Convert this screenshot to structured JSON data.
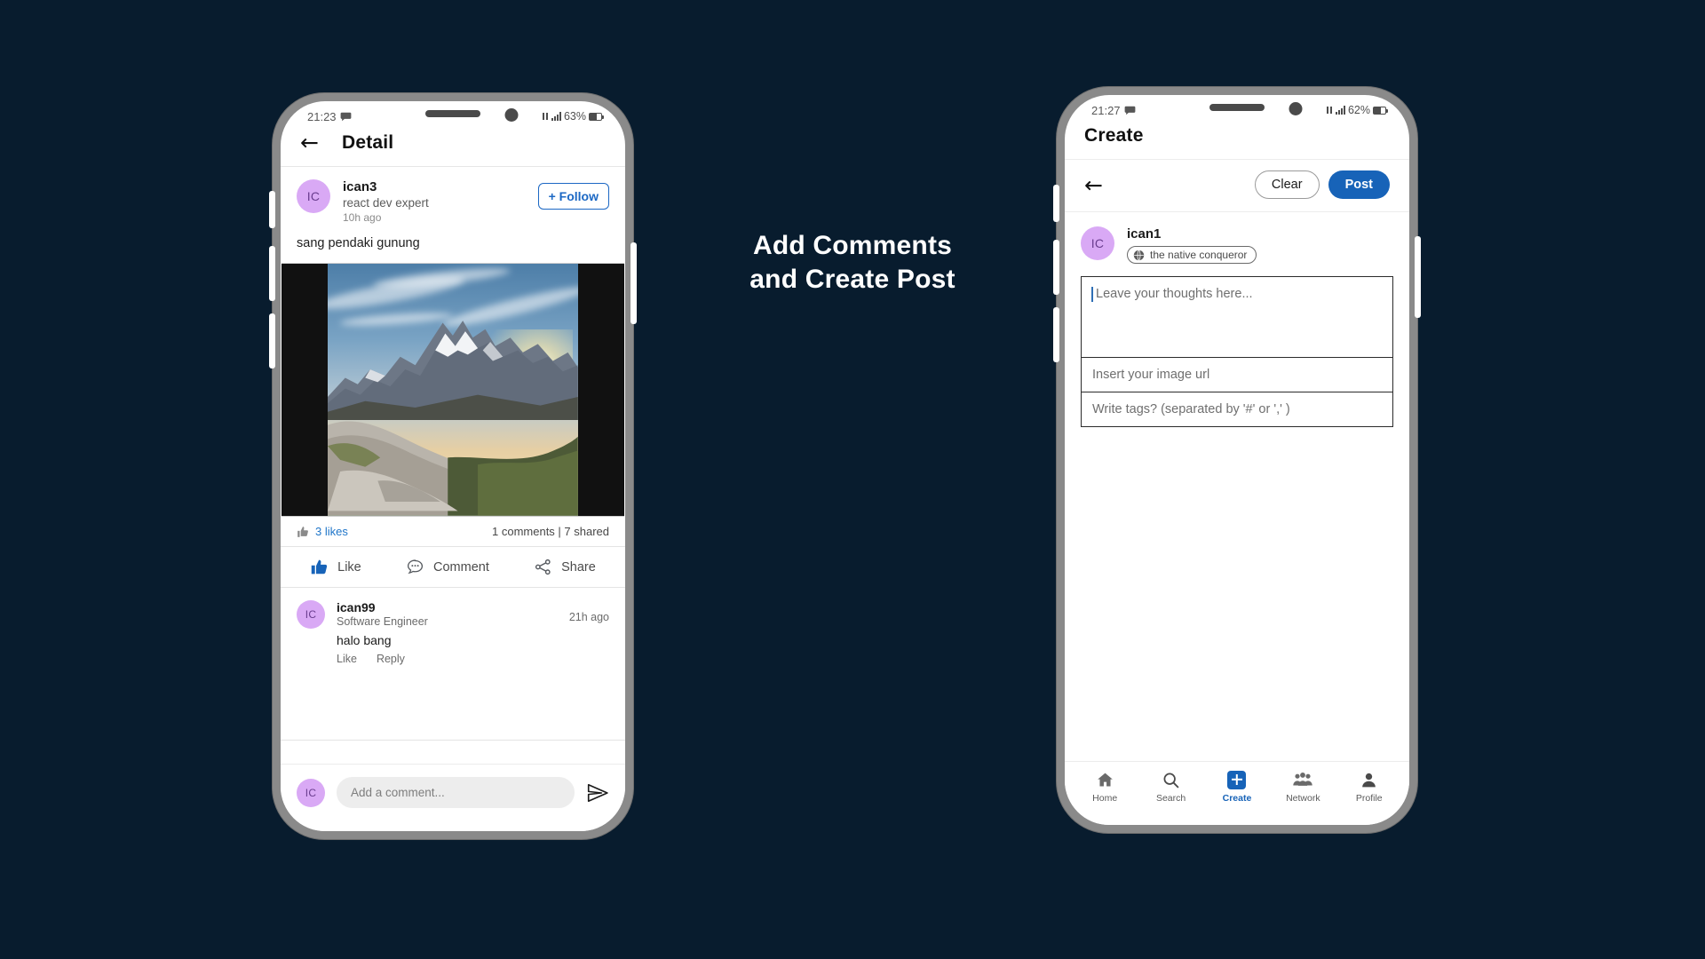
{
  "caption": {
    "line1": "Add Comments",
    "line2": "and Create Post"
  },
  "theme": {
    "background": "#081c2e",
    "accent": "#1763b8",
    "link": "#2076c9",
    "avatar_bg": "#d9a9f5"
  },
  "left_phone": {
    "status": {
      "time": "21:23",
      "battery": "63%"
    },
    "appbar": {
      "title": "Detail",
      "back_icon": "arrow-left-icon"
    },
    "post": {
      "avatar_initials": "IC",
      "username": "ican3",
      "headline": "react dev expert",
      "time": "10h ago",
      "follow_label": "+ Follow",
      "text": "sang pendaki gunung",
      "image_alt": "mountain sunrise landscape"
    },
    "stats": {
      "likes": "3 likes",
      "comments_shares": "1 comments | 7 shared",
      "thumb_icon": "thumbs-up-icon"
    },
    "actions": [
      {
        "label": "Like",
        "icon": "thumbs-up-icon"
      },
      {
        "label": "Comment",
        "icon": "comment-bubble-icon"
      },
      {
        "label": "Share",
        "icon": "share-icon"
      }
    ],
    "comments": [
      {
        "avatar_initials": "IC",
        "username": "ican99",
        "role": "Software Engineer",
        "time": "21h ago",
        "text": "halo bang",
        "like_label": "Like",
        "reply_label": "Reply"
      }
    ],
    "composer": {
      "avatar_initials": "IC",
      "placeholder": "Add a comment...",
      "send_icon": "send-icon"
    }
  },
  "right_phone": {
    "status": {
      "time": "21:27",
      "battery": "62%"
    },
    "appbar": {
      "title": "Create"
    },
    "toolbar": {
      "back_icon": "arrow-left-icon",
      "clear_label": "Clear",
      "post_label": "Post"
    },
    "user": {
      "avatar_initials": "IC",
      "username": "ican1",
      "badge_label": "the native conqueror",
      "badge_icon": "globe-icon"
    },
    "form": {
      "thoughts_placeholder": "Leave your thoughts here...",
      "image_url_placeholder": "Insert your image url",
      "tags_placeholder": "Write tags? (separated by '#' or ',' )"
    },
    "bottom_nav": [
      {
        "label": "Home",
        "icon": "home-icon",
        "active": false
      },
      {
        "label": "Search",
        "icon": "search-icon",
        "active": false
      },
      {
        "label": "Create",
        "icon": "plus-square-icon",
        "active": true
      },
      {
        "label": "Network",
        "icon": "people-group-icon",
        "active": false
      },
      {
        "label": "Profile",
        "icon": "person-icon",
        "active": false
      }
    ]
  }
}
